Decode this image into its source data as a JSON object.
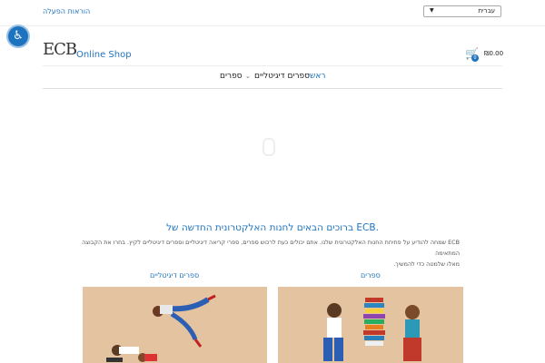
{
  "topbar": {
    "manual_link": "הוראות הפעלה",
    "language_selected": "עברית"
  },
  "header": {
    "logo_mark": "ECB",
    "logo_text": "Online Shop",
    "cart_count": "0",
    "cart_total": "₪0.00"
  },
  "nav": {
    "home": "ראשי",
    "digital_books": "ספרים דיגיטליים",
    "books": "ספרים"
  },
  "main": {
    "welcome_title": "ברוכים הבאים לחנות האלקטרונית החדשה של ECB.",
    "intro_line1": "ECB שמחה להודיע על פתיחת החנות האלקטרונית שלנו. אתם יכולים כעת לרכוש ספרים, ספרי קריאה דיגיטליים וספרים דיגיטליים לקיץ. בחרו את הקבוצה המתאימה",
    "intro_line2": "מאלו שלמטה כדי להמשיך."
  },
  "categories": {
    "books_title": "ספרים",
    "digital_title": "ספרים דיגיטליים"
  },
  "colors": {
    "accent": "#1e73be",
    "image_bg": "#e4c3a0"
  }
}
